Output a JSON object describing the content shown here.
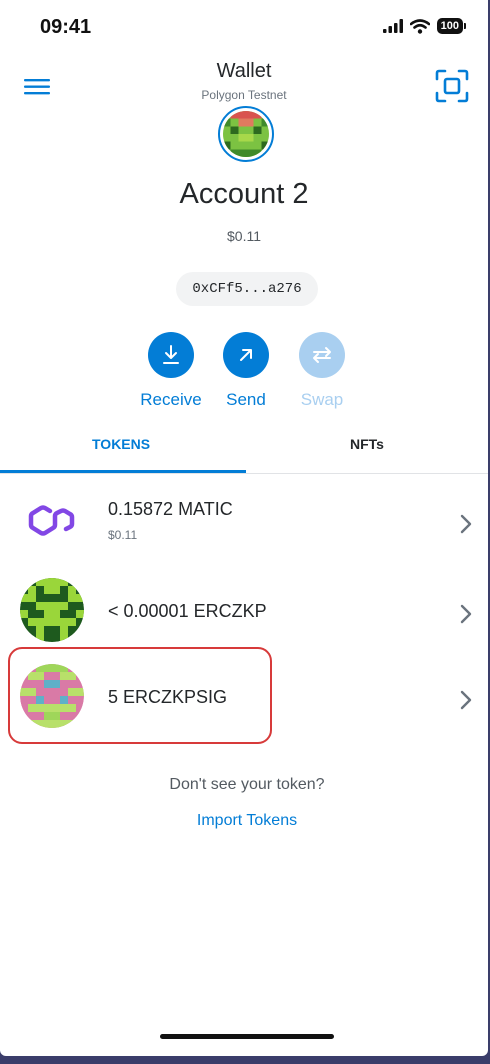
{
  "status_bar": {
    "time": "09:41",
    "battery": "100"
  },
  "header": {
    "title": "Wallet",
    "network": "Polygon Testnet"
  },
  "account": {
    "name": "Account 2",
    "balance": "$0.11",
    "address": "0xCFf5...a276"
  },
  "actions": [
    {
      "label": "Receive",
      "icon": "download-icon",
      "enabled": true
    },
    {
      "label": "Send",
      "icon": "arrow-up-right-icon",
      "enabled": true
    },
    {
      "label": "Swap",
      "icon": "swap-icon",
      "enabled": false
    }
  ],
  "tabs": [
    {
      "label": "TOKENS",
      "active": true
    },
    {
      "label": "NFTs",
      "active": false
    }
  ],
  "tokens": [
    {
      "amount": "0.15872 MATIC",
      "fiat": "$0.11",
      "icon": "polygon-logo-icon"
    },
    {
      "amount": "< 0.00001 ERCZKP",
      "fiat": "",
      "icon": "token-identicon"
    },
    {
      "amount": "5 ERCZKPSIG",
      "fiat": "",
      "icon": "token-identicon"
    }
  ],
  "footer": {
    "help_text": "Don't see your token?",
    "import_link": "Import Tokens"
  },
  "colors": {
    "accent": "#037dd6",
    "highlight": "#d73a3a",
    "polygon": "#8247e5"
  }
}
